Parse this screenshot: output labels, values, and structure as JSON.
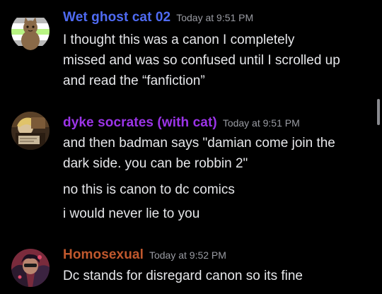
{
  "colors": {
    "background": "#000000",
    "message_text": "#e6e7ea",
    "timestamp": "#9a9ca3",
    "user1": "#4f6bf3",
    "user2": "#9b34e8",
    "user3": "#c0582d"
  },
  "messages": [
    {
      "username": "Wet ghost cat 02",
      "timestamp": "Today at 9:51 PM",
      "avatar_icon": "agender-flag-cat-avatar",
      "lines": [
        "I thought this was a canon I completely",
        "missed and was so confused until I scrolled up",
        "and read the “fanfiction”"
      ]
    },
    {
      "username": "dyke socrates (with cat)",
      "timestamp": "Today at 9:51 PM",
      "avatar_icon": "painting-portrait-avatar",
      "lines": [
        "and then badman says \"damian come join the",
        "dark side. you can be robbin 2\"",
        "no this is canon to dc comics",
        "i would never lie to you"
      ]
    },
    {
      "username": "Homosexual",
      "timestamp": "Today at 9:52 PM",
      "avatar_icon": "comic-character-avatar",
      "lines": [
        "Dc stands for disregard canon so its fine"
      ]
    }
  ]
}
